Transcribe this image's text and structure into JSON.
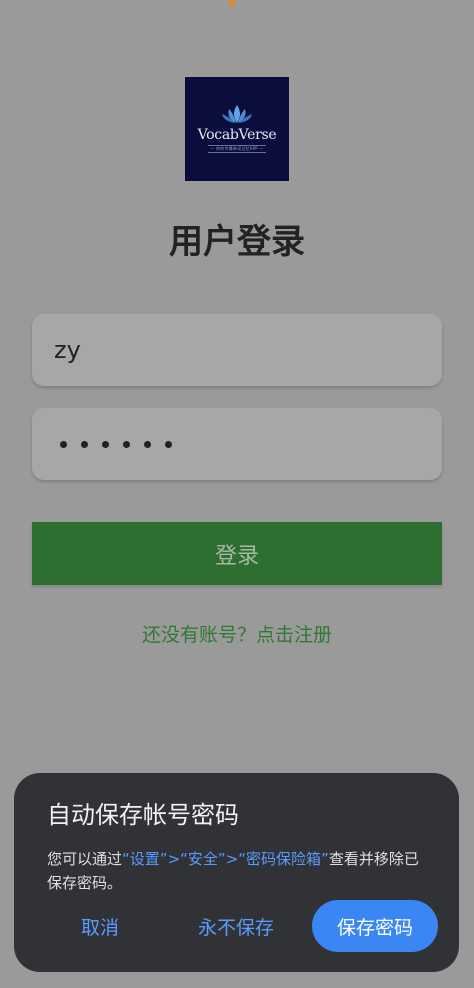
{
  "app": {
    "logo_name": "VocabVerse",
    "logo_tagline": "— 你的专属单词记忆APP —",
    "title": "用户登录"
  },
  "form": {
    "username_value": "zy",
    "password_mask_count": 6,
    "login_label": "登录",
    "register_link": "还没有账号？点击注册"
  },
  "dialog": {
    "title": "自动保存帐号密码",
    "message_prefix": "您可以通过",
    "path_settings": "“设置”",
    "sep1": ">",
    "path_security": "“安全”",
    "sep2": ">",
    "path_vault": "“密码保险箱”",
    "message_suffix": "查看并移除已保存密码。",
    "cancel_label": "取消",
    "never_label": "永不保存",
    "save_label": "保存密码"
  },
  "colors": {
    "overlay": "#9a9a9a",
    "button_green": "#2e6e31",
    "link_green": "#2f7a33",
    "dialog_bg": "#303235",
    "accent_blue": "#3a86f5"
  }
}
